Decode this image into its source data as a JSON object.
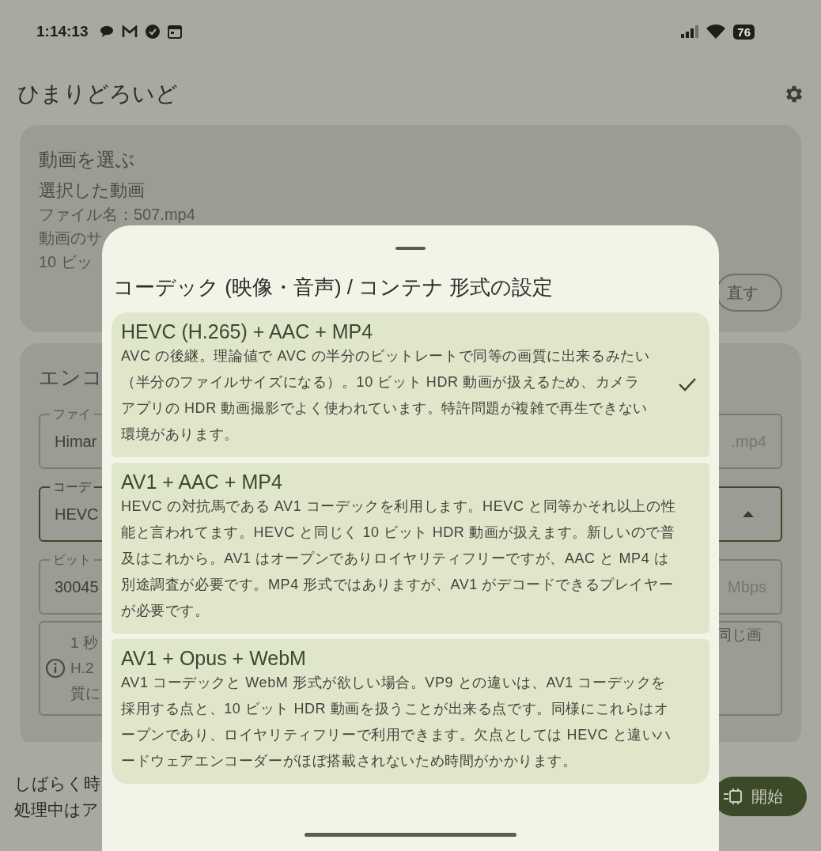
{
  "status_bar": {
    "time": "1:14:13",
    "battery": "76"
  },
  "app_bar": {
    "title": "ひまりどろいど"
  },
  "video_card": {
    "title": "動画を選ぶ",
    "subtitle": "選択した動画",
    "lines": [
      "ファイル名：507.mp4",
      "動画のサ",
      "10 ビッ"
    ],
    "button": "直す"
  },
  "encode_card": {
    "title": "エンコ",
    "fields": [
      {
        "kind": "text",
        "label": "ファイ",
        "value": "Himar",
        "suffix": ".mp4",
        "focused": false
      },
      {
        "kind": "dropdown",
        "label": "コーデ",
        "value": "HEVC",
        "focused": true,
        "expanded": true
      },
      {
        "kind": "text",
        "label": "ビット",
        "value": "30045",
        "suffix": "Mbps",
        "focused": false
      }
    ],
    "info": {
      "left_lines": [
        "1 秒",
        "H.2",
        "質に"
      ],
      "right_text": "同じ画"
    }
  },
  "bottom_bar": {
    "lines": [
      "しばらく時",
      "処理中はア"
    ],
    "button": "開始"
  },
  "sheet": {
    "title": "コーデック (映像・音声) / コンテナ 形式の設定",
    "options": [
      {
        "title": "HEVC (H.265) + AAC + MP4",
        "description": "AVC の後継。理論値で AVC の半分のビットレートで同等の画質に出来るみたい（半分のファイルサイズになる）。10 ビット HDR 動画が扱えるため、カメラアプリの HDR 動画撮影でよく使われています。特許問題が複雑で再生できない環境があります。",
        "selected": true
      },
      {
        "title": "AV1 + AAC + MP4",
        "description": "HEVC の対抗馬である AV1 コーデックを利用します。HEVC と同等かそれ以上の性能と言われてます。HEVC と同じく 10 ビット HDR 動画が扱えます。新しいので普及はこれから。AV1 はオープンでありロイヤリティフリーですが、AAC と MP4 は別途調査が必要です。MP4 形式ではありますが、AV1 がデコードできるプレイヤーが必要です。",
        "selected": false
      },
      {
        "title": "AV1 + Opus + WebM",
        "description": "AV1 コーデックと WebM 形式が欲しい場合。VP9 との違いは、AV1 コーデックを採用する点と、10 ビット HDR 動画を扱うことが出来る点です。同様にこれらはオープンであり、ロイヤリティフリーで利用できます。欠点としては HEVC と違いハードウェアエンコーダーがほぼ搭載されないため時間がかかります。",
        "selected": false
      }
    ]
  }
}
